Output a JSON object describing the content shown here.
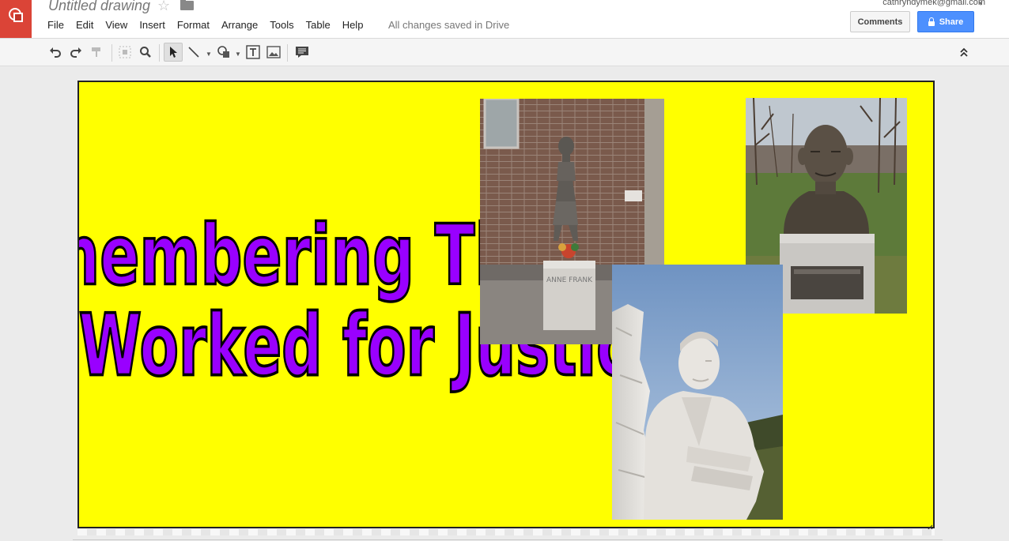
{
  "app": {
    "doc_title": "Untitled drawing",
    "save_status": "All changes saved in Drive",
    "account": "cathryndymek@gmail.com"
  },
  "menu": [
    "File",
    "Edit",
    "View",
    "Insert",
    "Format",
    "Arrange",
    "Tools",
    "Table",
    "Help"
  ],
  "buttons": {
    "comments": "Comments",
    "share": "Share"
  },
  "toolbar": [
    "undo-icon",
    "redo-icon",
    "paint-format-icon",
    "zoom-fit-icon",
    "zoom-icon",
    "select-icon",
    "line-icon",
    "shape-icon",
    "text-box-icon",
    "image-icon",
    "comment-icon",
    "collapse-icon"
  ],
  "canvas": {
    "background": "#ffff00",
    "title_line1": "Remembering Those",
    "title_line2": "Who Worked for Justice",
    "title_fill": "#9900ff",
    "title_stroke": "#000000",
    "pedestal_anne": "ANNE FRANK"
  }
}
